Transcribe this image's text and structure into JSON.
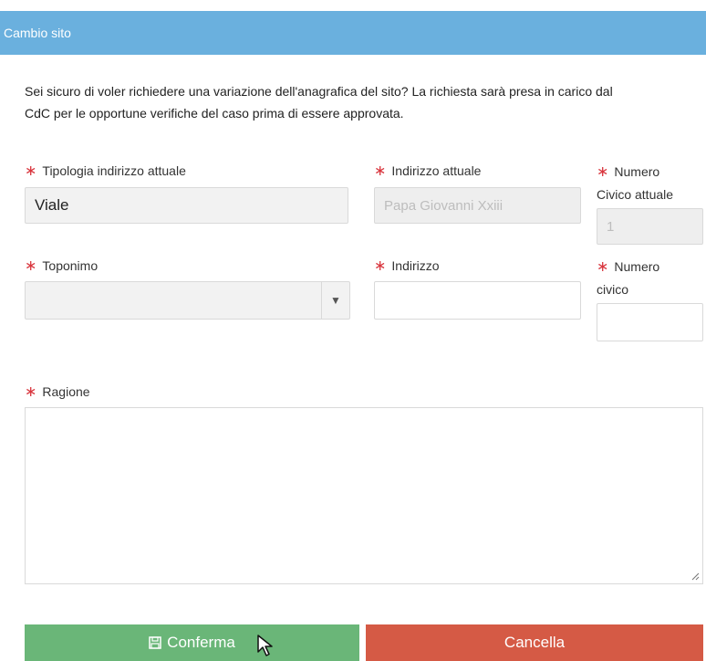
{
  "dialog": {
    "title": "Cambio sito"
  },
  "intro": {
    "line1": "Sei sicuro di voler richiedere una variazione dell'anagrafica del sito? La richiesta sarà presa in carico dal",
    "line2": "CdC per le opportune verifiche del caso prima di essere approvata."
  },
  "required_marker": "∗",
  "fields": {
    "tipologia_attuale": {
      "label": "Tipologia indirizzo attuale",
      "value": "Viale"
    },
    "indirizzo_attuale": {
      "label": "Indirizzo attuale",
      "value": "Papa Giovanni Xxiii"
    },
    "numero_civico_attuale": {
      "label_line1": "Numero",
      "label_line2": "Civico attuale",
      "value": "1"
    },
    "toponimo": {
      "label": "Toponimo",
      "value": ""
    },
    "indirizzo": {
      "label": "Indirizzo",
      "value": ""
    },
    "numero_civico": {
      "label_line1": "Numero",
      "label_line2": "civico",
      "value": ""
    },
    "ragione": {
      "label": "Ragione",
      "value": ""
    }
  },
  "buttons": {
    "confirm": {
      "label": "Conferma",
      "icon": "save-icon",
      "color": "#6ab678"
    },
    "cancel": {
      "label": "Cancella",
      "color": "#d55a45"
    }
  },
  "colors": {
    "header": "#6ab0de",
    "required": "#d9363e"
  }
}
